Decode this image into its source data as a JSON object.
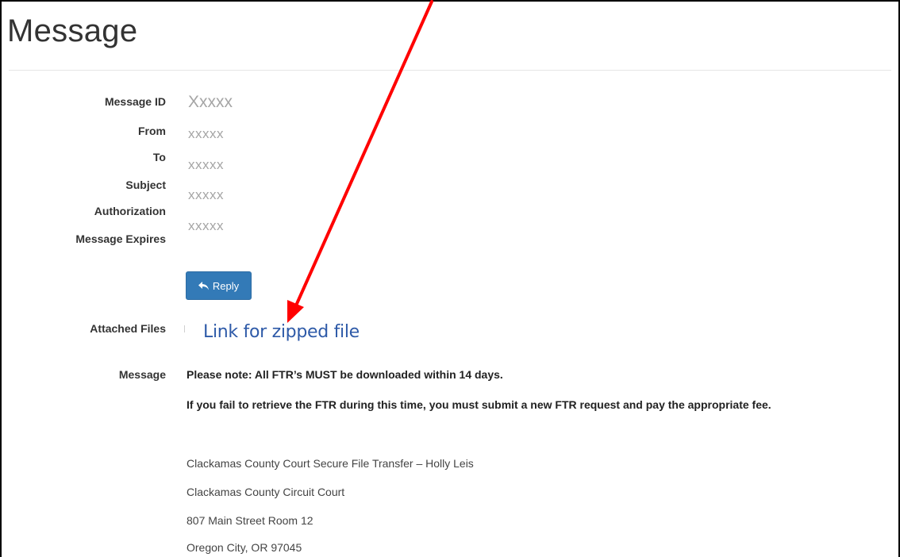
{
  "page": {
    "title": "Message"
  },
  "fields": [
    {
      "label": "Message ID",
      "value": "Xxxxx"
    },
    {
      "label": "From",
      "value": "xxxxx"
    },
    {
      "label": "To",
      "value": "xxxxx"
    },
    {
      "label": "Subject",
      "value": "xxxxx"
    },
    {
      "label": "Authorization",
      "value": "xxxxx"
    },
    {
      "label": "Message Expires",
      "value": ""
    }
  ],
  "actions": {
    "reply_label": "Reply",
    "reply_icon": "reply-arrow-icon"
  },
  "attachments": {
    "label": "Attached Files",
    "link_text": "Link for zipped file"
  },
  "message": {
    "label": "Message",
    "lines": [
      "Please note: All FTR’s MUST be downloaded within 14 days.",
      "If you fail to retrieve the FTR during this time, you must submit a new FTR request and pay the appropriate fee."
    ],
    "signature": [
      "Clackamas County Court Secure File Transfer – Holly Leis",
      "Clackamas County Circuit Court",
      "807 Main Street Room 12",
      "Oregon City, OR 97045"
    ]
  },
  "annotation": {
    "arrow_color": "#ff0000"
  }
}
